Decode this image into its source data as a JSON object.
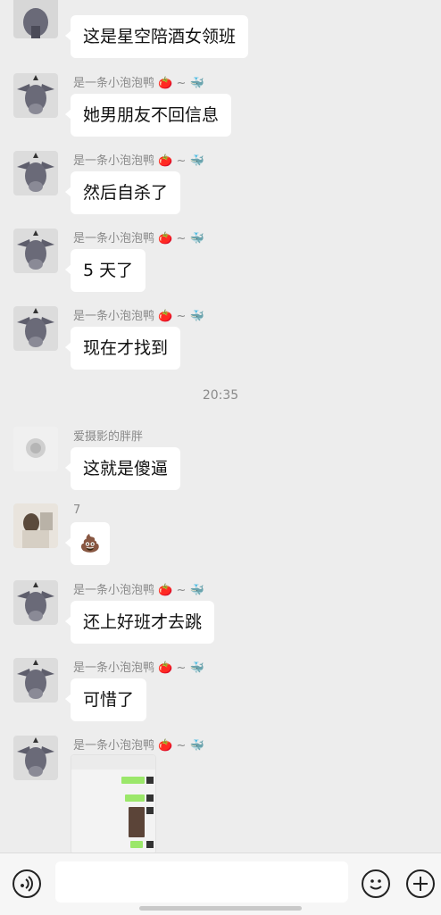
{
  "chat": {
    "messages": [
      {
        "sender": "",
        "text": "这是星空陪酒女领班"
      },
      {
        "sender": "是一条小泡泡鸭",
        "text": "她男朋友不回信息"
      },
      {
        "sender": "是一条小泡泡鸭",
        "text": "然后自杀了"
      },
      {
        "sender": "是一条小泡泡鸭",
        "text": "5 天了"
      },
      {
        "sender": "是一条小泡泡鸭",
        "text": "现在才找到"
      },
      {
        "sender": "爱摄影的胖胖",
        "text": "这就是傻逼"
      },
      {
        "sender": "7",
        "text": "💩"
      },
      {
        "sender": "是一条小泡泡鸭",
        "text": "还上好班才去跳"
      },
      {
        "sender": "是一条小泡泡鸭",
        "text": "可惜了"
      },
      {
        "sender": "是一条小泡泡鸭",
        "text": ""
      }
    ],
    "timestamp": "20:35",
    "name_suffix": "~"
  },
  "input_bar": {
    "voice_icon": "voice-icon",
    "emoji_icon": "emoji-icon",
    "plus_icon": "plus-icon"
  },
  "colors": {
    "background": "#ededed",
    "bubble": "#ffffff",
    "name": "#8a8a8a"
  }
}
